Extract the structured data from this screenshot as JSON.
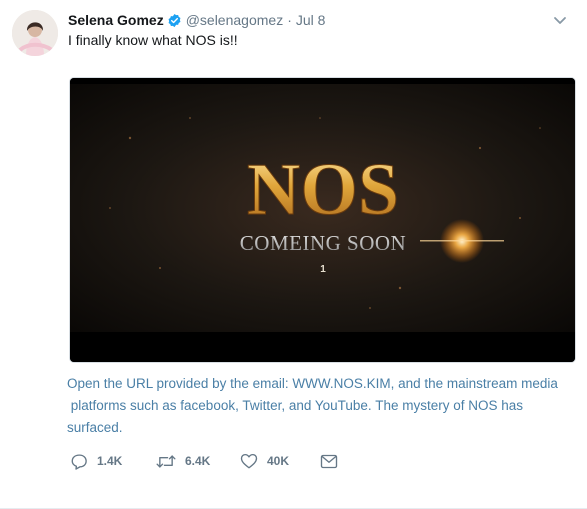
{
  "tweet": {
    "author_name": "Selena Gomez",
    "author_handle": "@selenagomez",
    "separator": "·",
    "date": "Jul 8",
    "text": "I finally know what NOS is!!",
    "media": {
      "title": "NOS",
      "subtitle": "COMEING SOON",
      "number": "1"
    },
    "caption_line1": "Open the URL provided by the email: WWW.NOS.KIM, and the mainstream media",
    "caption_line2": " platforms such as facebook, Twitter, and YouTube. The mystery of NOS has",
    "caption_line3": "surfaced.",
    "actions": {
      "reply_count": "1.4K",
      "retweet_count": "6.4K",
      "like_count": "40K"
    }
  },
  "icons": {
    "verified": "verified-badge-icon",
    "menu": "chevron-down-icon",
    "reply": "reply-icon",
    "retweet": "retweet-icon",
    "like": "heart-icon",
    "message": "envelope-icon"
  },
  "colors": {
    "verified_blue": "#1da1f2",
    "caption_link": "#4a7fa6",
    "muted": "#657786",
    "gold": "#e0a63a"
  }
}
